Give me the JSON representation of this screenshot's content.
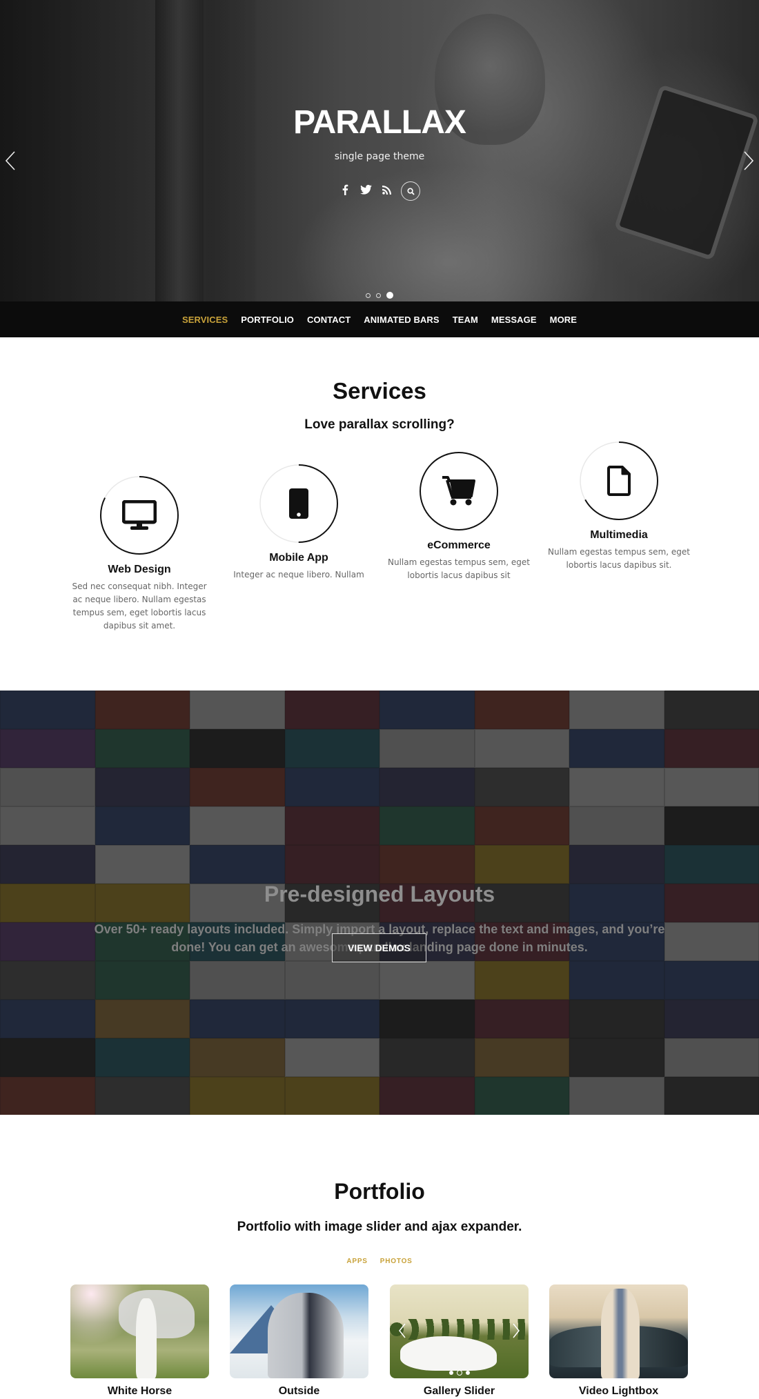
{
  "hero": {
    "title": "PARALLAX",
    "subtitle": "single page theme",
    "social": [
      {
        "name": "facebook-icon",
        "glyph": "f"
      },
      {
        "name": "twitter-icon",
        "glyph": "🐦"
      },
      {
        "name": "rss-icon",
        "glyph": "rss"
      }
    ],
    "search_icon": "search-icon",
    "slides_total": 3,
    "slide_active": 3
  },
  "nav": {
    "items": [
      {
        "label": "SERVICES",
        "active": true
      },
      {
        "label": "PORTFOLIO",
        "active": false
      },
      {
        "label": "CONTACT",
        "active": false
      },
      {
        "label": "ANIMATED BARS",
        "active": false
      },
      {
        "label": "TEAM",
        "active": false
      },
      {
        "label": "MESSAGE",
        "active": false
      },
      {
        "label": "MORE",
        "active": false
      }
    ]
  },
  "services": {
    "title": "Services",
    "subtitle": "Love parallax scrolling?",
    "items": [
      {
        "title": "Web Design",
        "icon": "monitor-icon",
        "text": "Sed nec consequat nibh. Integer ac neque libero. Nullam egestas tempus sem, eget lobortis lacus dapibus sit amet."
      },
      {
        "title": "Mobile App",
        "icon": "mobile-phone-icon",
        "text": "Integer ac neque libero. Nullam"
      },
      {
        "title": "eCommerce",
        "icon": "shopping-cart-icon",
        "text": "Nullam egestas tempus sem, eget lobortis lacus dapibus sit"
      },
      {
        "title": "Multimedia",
        "icon": "file-icon",
        "text": "Nullam egestas tempus sem, eget lobortis lacus dapibus sit."
      }
    ]
  },
  "layouts": {
    "title": "Pre-designed Layouts",
    "text": "Over 50+ ready layouts included. Simply import a layout, replace the text and images, and you’re done! You can get an awesome parallax landing page done in minutes.",
    "button": "VIEW DEMOS"
  },
  "portfolio": {
    "title": "Portfolio",
    "subtitle": "Portfolio with image slider and ajax expander.",
    "filters": [
      "APPS",
      "PHOTOS"
    ],
    "items": [
      {
        "title": "White Horse"
      },
      {
        "title": "Outside"
      },
      {
        "title": "Gallery Slider",
        "slides_total": 3,
        "slide_active": 2
      },
      {
        "title": "Video Lightbox"
      }
    ]
  },
  "colors": {
    "accent": "#c8a23a",
    "navbar": "#0c0c0c",
    "text": "#111111"
  }
}
